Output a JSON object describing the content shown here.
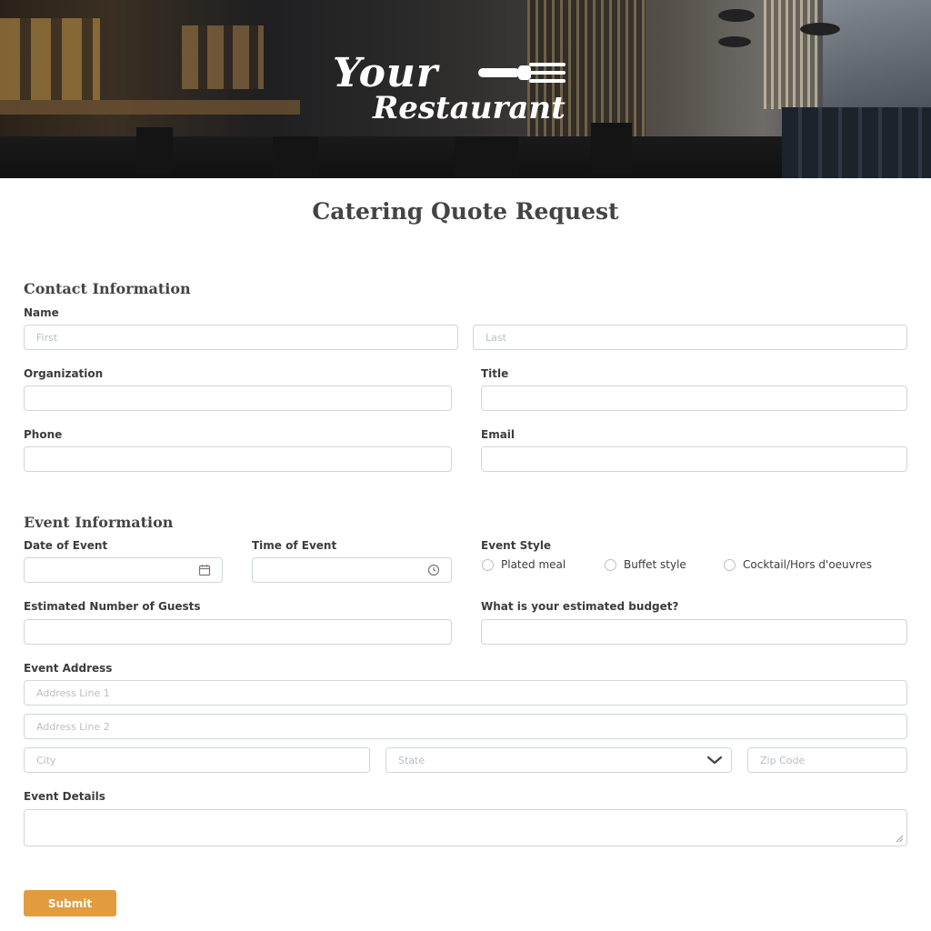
{
  "banner": {
    "brand_line1": "Your",
    "brand_line2": "Restaurant"
  },
  "form": {
    "title": "Catering Quote Request",
    "contact_section": "Contact Information",
    "name_label": "Name",
    "first_placeholder": "First",
    "last_placeholder": "Last",
    "organization_label": "Organization",
    "title_label": "Title",
    "phone_label": "Phone",
    "email_label": "Email",
    "event_section": "Event Information",
    "date_label": "Date of Event",
    "time_label": "Time of Event",
    "style_label": "Event Style",
    "style_options": [
      "Plated meal",
      "Buffet style",
      "Cocktail/Hors d'oeuvres"
    ],
    "guests_label": "Estimated Number of Guests",
    "budget_label": "What is your estimated budget?",
    "address_label": "Event Address",
    "address1_placeholder": "Address Line 1",
    "address2_placeholder": "Address Line 2",
    "city_placeholder": "City",
    "state_placeholder": "State",
    "zip_placeholder": "Zip Code",
    "details_label": "Event Details",
    "submit_label": "Submit"
  },
  "colors": {
    "accent": "#e39b3f",
    "border": "#cfd6de",
    "heading": "#444444"
  },
  "icons": [
    "fork-icon",
    "calendar-icon",
    "clock-icon",
    "chevron-down-icon",
    "resize-handle-icon"
  ]
}
